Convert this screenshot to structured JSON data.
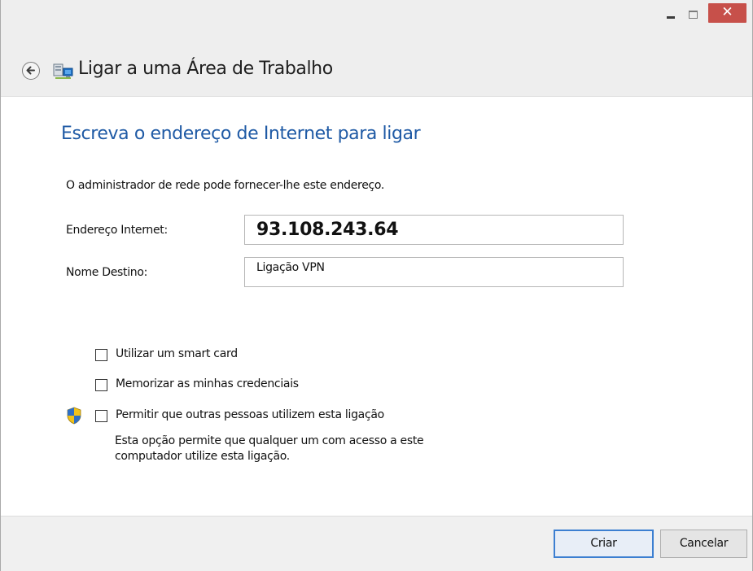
{
  "window": {
    "title": "Ligar a uma Área de Trabalho",
    "close_glyph": "✕",
    "accent_color": "#1f5aa5",
    "close_color": "#c7504a"
  },
  "page": {
    "heading": "Escreva o endereço de Internet para ligar",
    "intro": "O administrador de rede pode fornecer-lhe este endereço."
  },
  "form": {
    "address_label": "Endereço Internet:",
    "address_value": "93.108.243.64",
    "name_label": "Nome Destino:",
    "name_value": "Ligação VPN"
  },
  "options": [
    {
      "label": "Utilizar um smart card",
      "checked": false
    },
    {
      "label": "Memorizar as minhas credenciais",
      "checked": false
    },
    {
      "label": "Permitir que outras pessoas utilizem esta ligação",
      "checked": false
    }
  ],
  "share_note": {
    "line1": "Esta opção permite que qualquer um com acesso a este",
    "line2": "computador utilize esta ligação."
  },
  "footer": {
    "create_label": "Criar",
    "cancel_label": "Cancelar"
  },
  "icons": {
    "back": "back-arrow-icon",
    "app": "remote-workplace-icon",
    "shield": "uac-shield-icon"
  }
}
